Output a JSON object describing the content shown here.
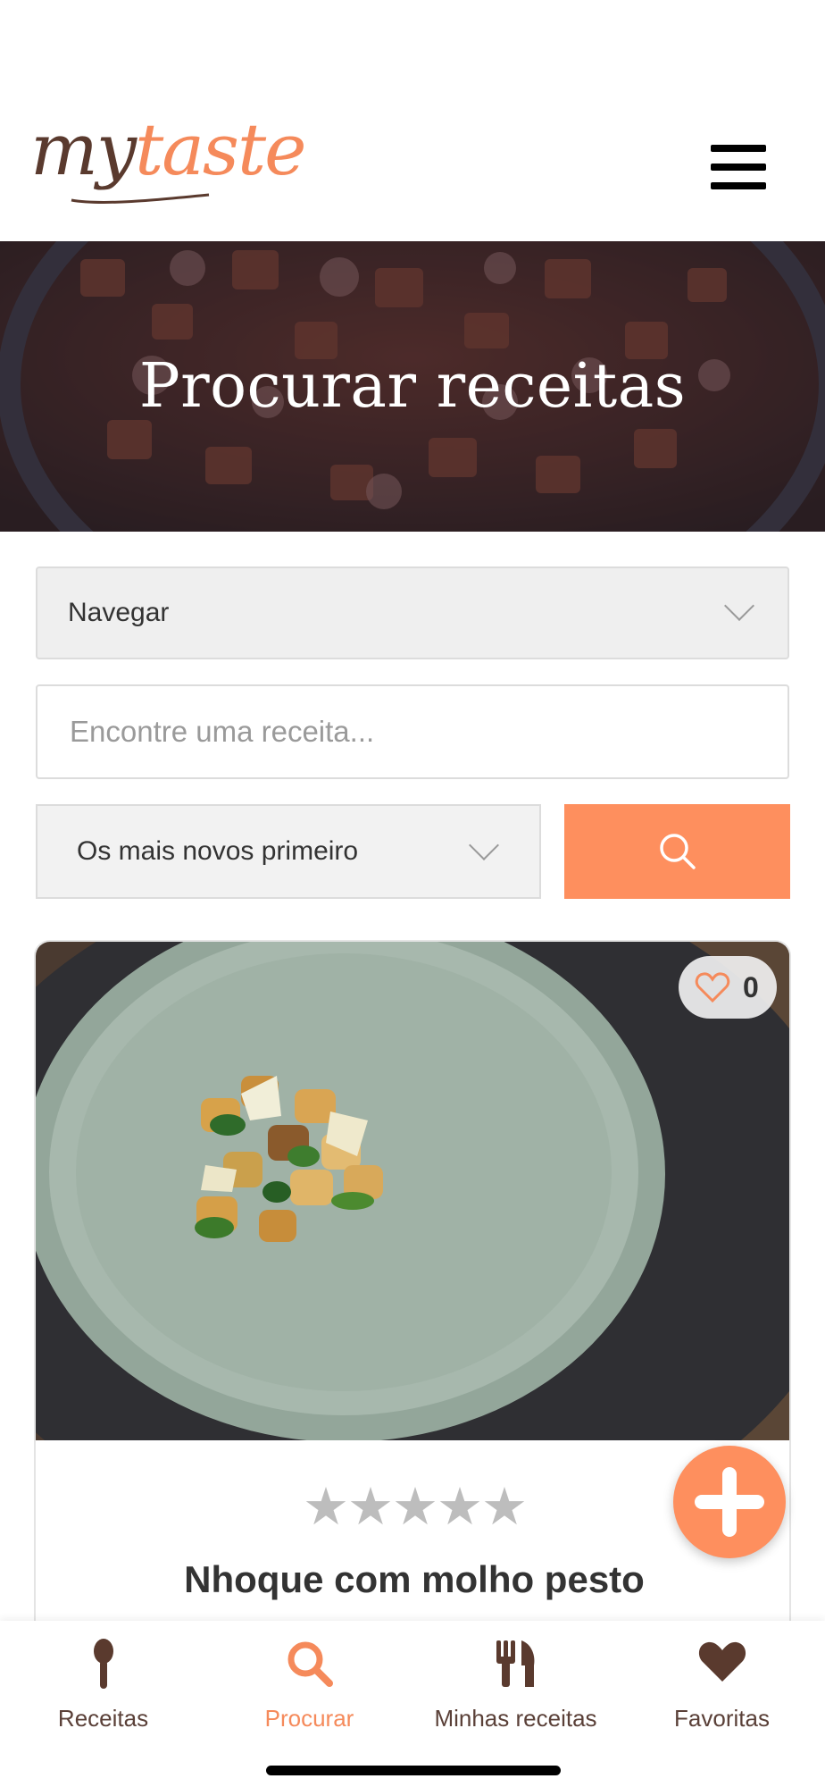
{
  "header": {
    "logo_part1": "my",
    "logo_part2": "taste",
    "menu_icon": "hamburger-icon"
  },
  "hero": {
    "title": "Procurar receitas"
  },
  "filters": {
    "browse_value": "Navegar",
    "search_placeholder": "Encontre uma receita...",
    "sort_value": "Os mais novos primeiro",
    "search_button_icon": "search-icon"
  },
  "recipe_card": {
    "likes": "0",
    "rating_stars": "★★★★★",
    "rating_value": 0,
    "title": "Nhoque com molho pesto"
  },
  "fab": {
    "icon": "plus-icon"
  },
  "bottom_nav": {
    "items": [
      {
        "label": "Receitas",
        "icon": "spoon-icon",
        "active": false
      },
      {
        "label": "Procurar",
        "icon": "search-icon",
        "active": true
      },
      {
        "label": "Minhas receitas",
        "icon": "fork-knife-icon",
        "active": false
      },
      {
        "label": "Favoritas",
        "icon": "heart-icon",
        "active": false
      }
    ]
  },
  "colors": {
    "accent": "#fe8f5e",
    "brown": "#5a3a2e",
    "nav_label": "#5a4038"
  }
}
